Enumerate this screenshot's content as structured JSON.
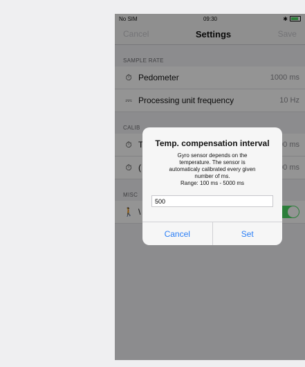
{
  "status_bar": {
    "carrier": "No SIM",
    "time": "09:30",
    "bluetooth": "✱"
  },
  "navbar": {
    "cancel": "Cancel",
    "title": "Settings",
    "save": "Save"
  },
  "sections": {
    "sample_rate": {
      "header": "SAMPLE RATE",
      "rows": [
        {
          "icon": "stopwatch-icon",
          "label": "Pedometer",
          "value": "1000 ms"
        },
        {
          "icon": "frequency-icon",
          "label": "Processing unit frequency",
          "value": "10 Hz"
        }
      ]
    },
    "calibration": {
      "header": "CALIB",
      "rows": [
        {
          "icon": "stopwatch-icon",
          "label": "T",
          "value": "00 ms"
        },
        {
          "icon": "stopwatch-icon",
          "label": "(",
          "value": "00 ms"
        }
      ]
    },
    "misc": {
      "header": "MISC",
      "rows": [
        {
          "icon": "walking-icon",
          "label": "\\",
          "toggle_on": true
        }
      ]
    }
  },
  "alert": {
    "title": "Temp. compensation interval",
    "message_lines": [
      "Gyro sensor depends on the",
      "temperature. The sensor is",
      "automaticaly calibrated every given",
      "number of ms.",
      "Range: 100 ms - 5000 ms"
    ],
    "input_value": "500",
    "cancel_label": "Cancel",
    "set_label": "Set"
  },
  "colors": {
    "accent": "#2a7ef6",
    "toggle_on": "#4cd964"
  }
}
